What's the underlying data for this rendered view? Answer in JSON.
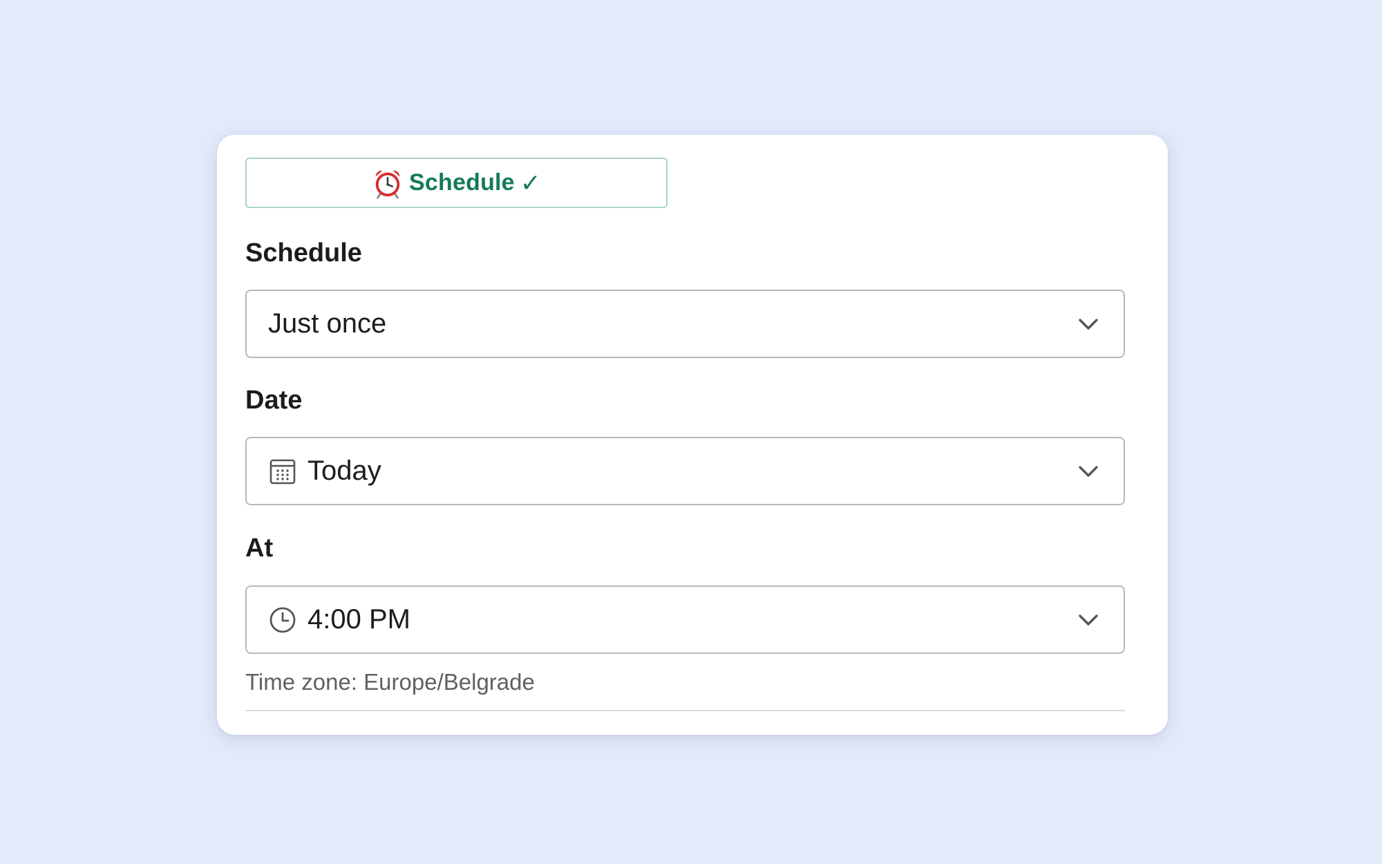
{
  "status_button": {
    "label": "Schedule",
    "check": "✓",
    "icon": "alarm-clock-icon",
    "accent_color": "#157a5a"
  },
  "schedule": {
    "label": "Schedule",
    "value": "Just once"
  },
  "date": {
    "label": "Date",
    "value": "Today",
    "icon": "calendar-icon"
  },
  "at": {
    "label": "At",
    "value": "4:00 PM",
    "icon": "clock-icon"
  },
  "timezone_note": "Time zone: Europe/Belgrade",
  "colors": {
    "background": "#e4eafa",
    "card": "#ffffff",
    "accent": "#157a5a",
    "alarm_red": "#d62b2b"
  }
}
